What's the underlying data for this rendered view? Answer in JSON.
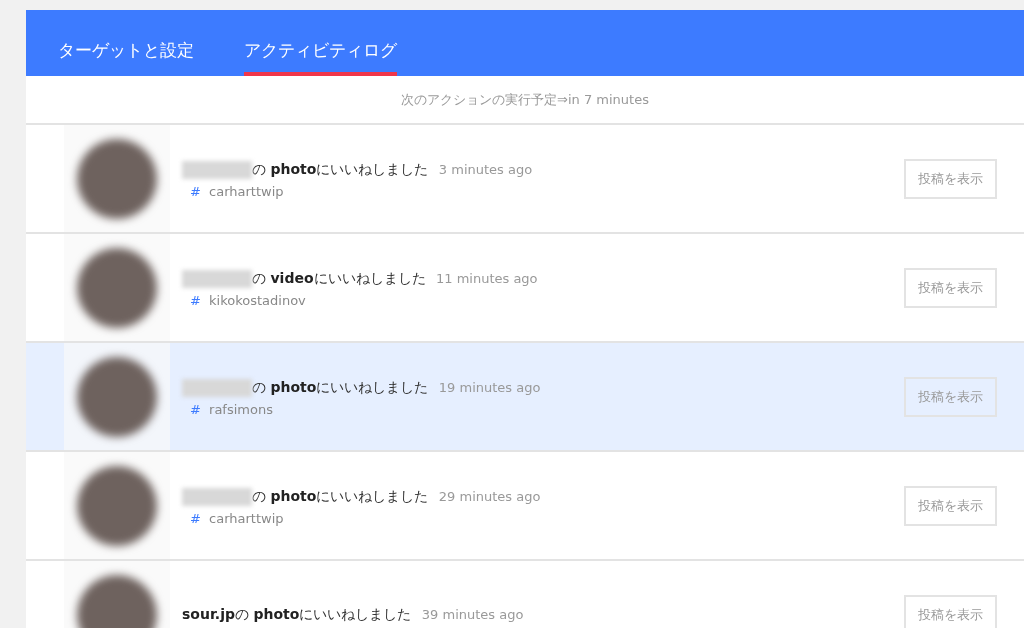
{
  "tabs": [
    {
      "label": "ターゲットと設定",
      "selected": false
    },
    {
      "label": "アクティビティログ",
      "selected": true
    }
  ],
  "next_action": "次のアクションの実行予定⇒in 7 minutes",
  "activities": [
    {
      "username_redacted": true,
      "message": "の **photo**にいいねしました",
      "time": "3 minutes ago",
      "hashtag_mark": "#",
      "hashtag": "carharttwip",
      "selected": false,
      "button": "投稿を表示"
    },
    {
      "username_redacted": true,
      "message": "の **video**にいいねしました",
      "time": "11 minutes ago",
      "hashtag_mark": "#",
      "hashtag": "kikokostadinov",
      "selected": false,
      "button": "投稿を表示"
    },
    {
      "username_redacted": true,
      "message": "の **photo**にいいねしました",
      "time": "19 minutes ago",
      "hashtag_mark": "#",
      "hashtag": "rafsimons",
      "selected": true,
      "button": "投稿を表示"
    },
    {
      "username_redacted": true,
      "message": "の **photo**にいいねしました",
      "time": "29 minutes ago",
      "hashtag_mark": "#",
      "hashtag": "carharttwip",
      "selected": false,
      "button": "投稿を表示"
    },
    {
      "username_redacted": false,
      "message": "**sour.jp**の **photo**にいいねしました",
      "time": "39 minutes ago",
      "selected": false,
      "button": "投稿を表示"
    }
  ]
}
